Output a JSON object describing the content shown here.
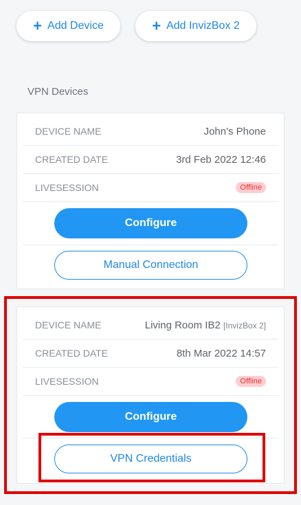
{
  "header": {
    "add_device": {
      "icon": "plus-icon",
      "label": "Add Device"
    },
    "add_invizbox": {
      "icon": "plus-icon",
      "label": "Add InvizBox 2"
    }
  },
  "section_title": "VPN Devices",
  "devices": [
    {
      "rows": [
        {
          "label": "DEVICE NAME",
          "value": "John's Phone"
        },
        {
          "label": "CREATED DATE",
          "value": "3rd Feb 2022 12:46"
        },
        {
          "label": "LIVESESSION",
          "status": "Offline"
        }
      ],
      "primary_button": "Configure",
      "secondary_button": "Manual Connection"
    },
    {
      "rows": [
        {
          "label": "DEVICE NAME",
          "value": "Living Room IB2",
          "tag": "[InvizBox 2]"
        },
        {
          "label": "CREATED DATE",
          "value": "8th Mar 2022 14:57"
        },
        {
          "label": "LIVESESSION",
          "status": "Offline"
        }
      ],
      "primary_button": "Configure",
      "secondary_button": "VPN Credentials"
    }
  ],
  "colors": {
    "accent": "#2196f3",
    "offline_badge_bg": "#ffcdd2",
    "offline_badge_text": "#e53935",
    "highlight": "#e00000"
  }
}
